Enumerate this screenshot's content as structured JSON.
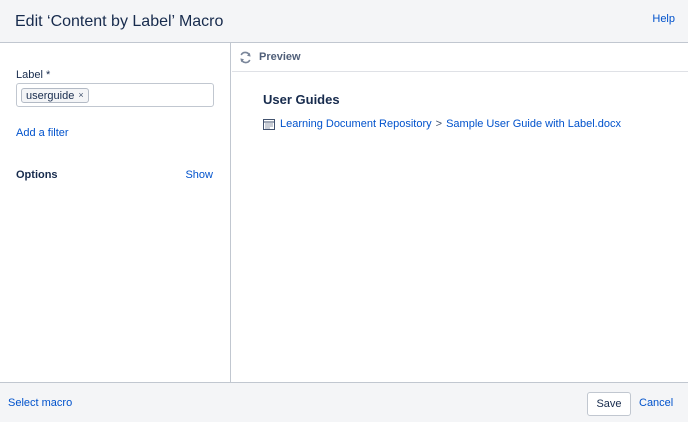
{
  "header": {
    "title": "Edit ‘Content by Label’ Macro",
    "help_label": "Help"
  },
  "left_pane": {
    "label_field": {
      "label": "Label *",
      "tags": [
        "userguide"
      ],
      "tag_remove_glyph": "×"
    },
    "add_filter_label": "Add a filter",
    "options": {
      "label": "Options",
      "show_label": "Show"
    }
  },
  "preview": {
    "title": "Preview",
    "refresh_icon": "refresh-icon",
    "heading": "User Guides",
    "items": [
      {
        "icon": "document-icon",
        "parent": "Learning Document Repository",
        "separator": ">",
        "name": "Sample User Guide with Label.docx"
      }
    ]
  },
  "footer": {
    "select_macro_label": "Select macro",
    "save_label": "Save",
    "cancel_label": "Cancel"
  },
  "colors": {
    "link": "#0052cc",
    "text": "#172b4d",
    "header_bg": "#f4f5f7",
    "border": "#c1c7d0"
  }
}
